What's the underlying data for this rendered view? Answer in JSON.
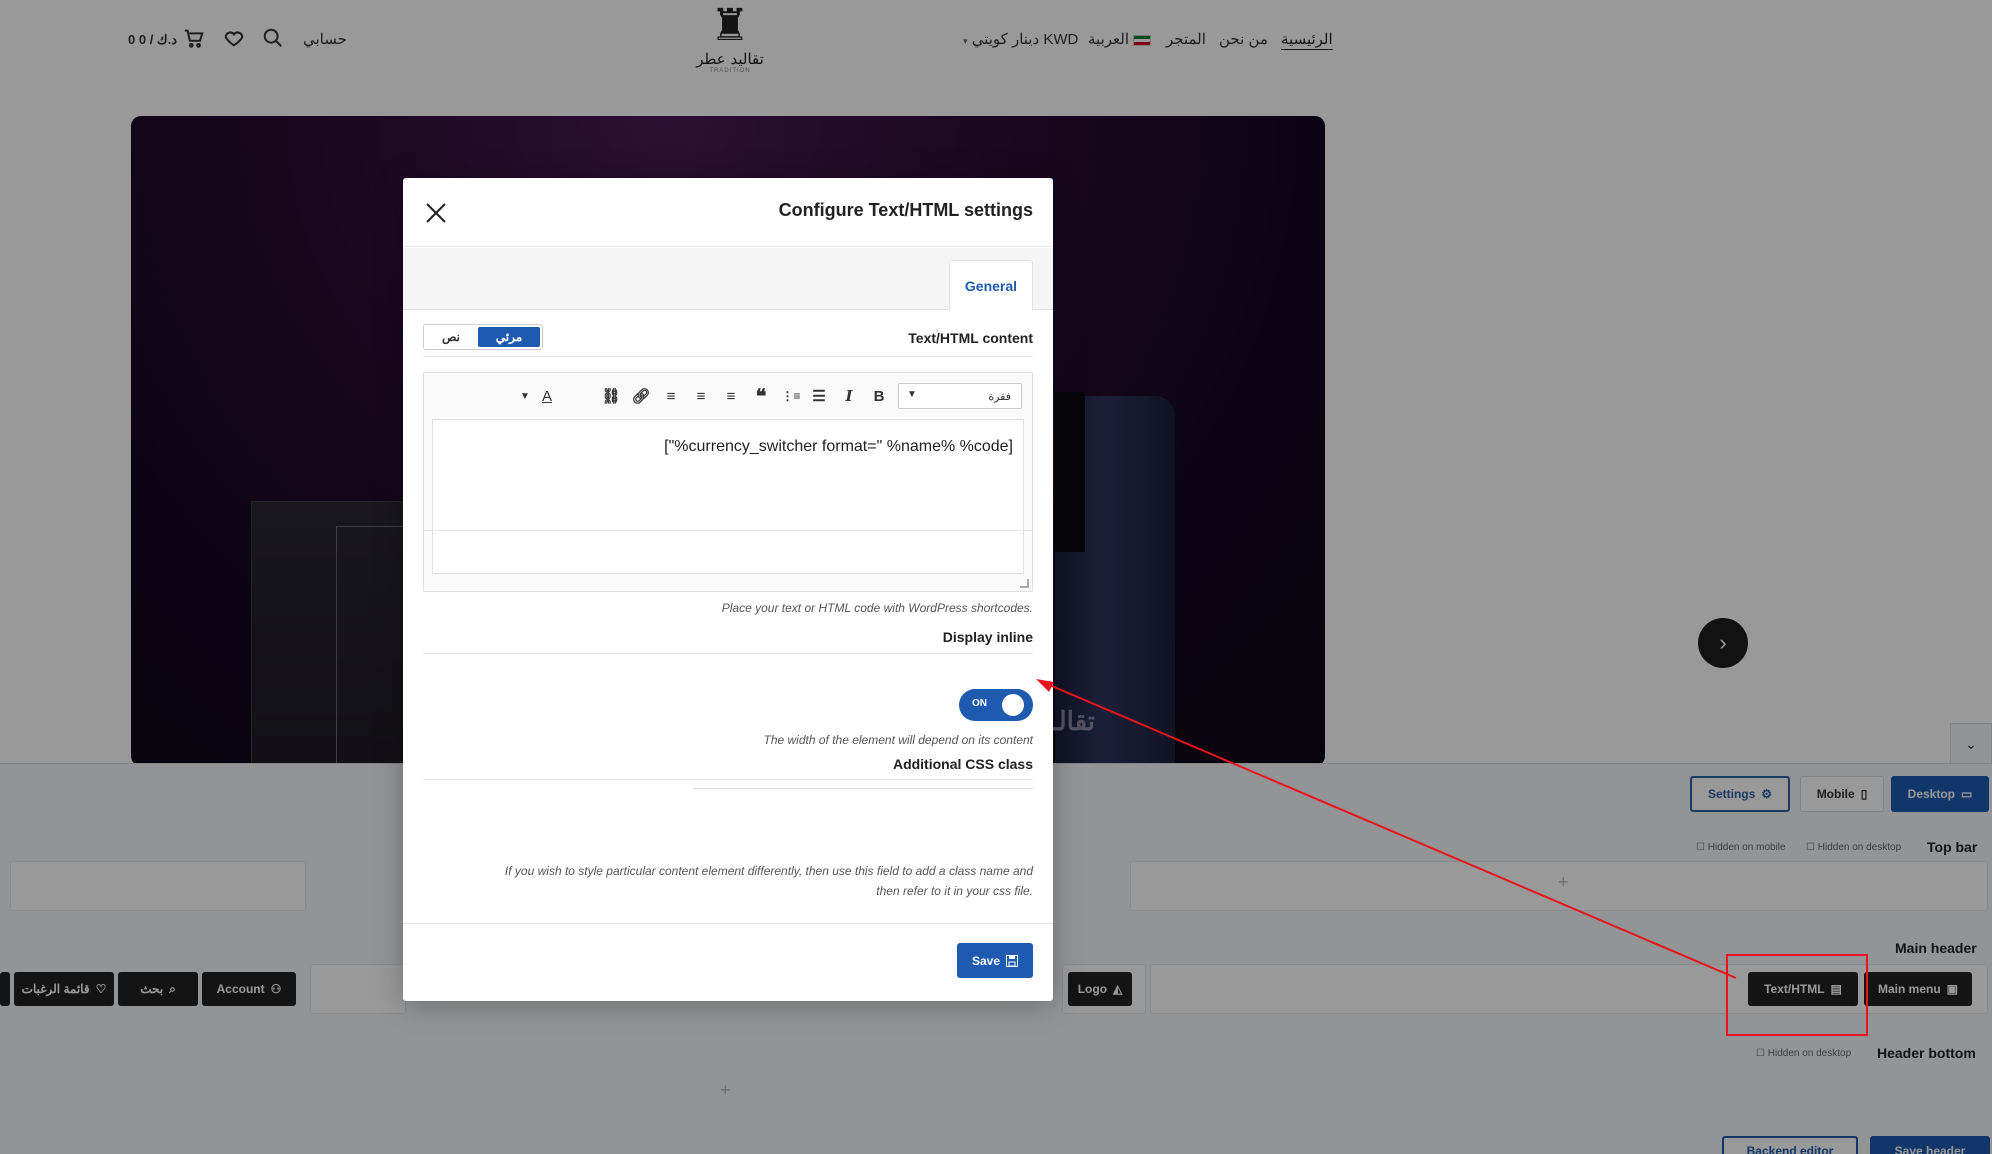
{
  "site": {
    "nav": {
      "home": "الرئيسية",
      "about": "من نحن",
      "shop": "المتجر",
      "language": "العربية",
      "currency": "دينار كويتي KWD",
      "account": "حسابي",
      "cart": "0 د.ك / 0"
    },
    "logo": {
      "name": "تقاليد عطر",
      "sub": "TRADITION"
    },
    "hero_brand": "تقالـ"
  },
  "builder": {
    "buttons": {
      "settings": "Settings",
      "mobile": "Mobile",
      "desktop": "Desktop"
    },
    "rows": {
      "top_bar": "Top bar",
      "main_header": "Main header",
      "header_bottom": "Header bottom",
      "hidden_mobile": "Hidden on mobile",
      "hidden_desktop": "Hidden on desktop"
    },
    "elements": {
      "main_menu": "Main menu",
      "text_html": "Text/HTML",
      "logo": "Logo",
      "account": "Account",
      "search": "بحث",
      "wishlist": "قائمة الرغبات"
    },
    "bottom": {
      "backend_editor": "Backend editor",
      "save_header": "Save header"
    }
  },
  "modal": {
    "title": "Configure Text/HTML settings",
    "tab_general": "General",
    "content_label": "Text/HTML content",
    "mode_visual": "مرئي",
    "mode_text": "نص",
    "format_value": "فقرة",
    "editor_content": "[\"%currency_switcher format=\" %name% %code]",
    "content_desc": "Place your text or HTML code with WordPress shortcodes.",
    "display_inline_label": "Display inline",
    "toggle_on": "ON",
    "display_inline_desc": "The width of the element will depend on its content",
    "css_label": "Additional CSS class",
    "css_value": "",
    "css_desc_1": "If you wish to style particular content element differently, then use this field to add a class name and",
    "css_desc_2": "then refer to it in your css file.",
    "save": "Save"
  },
  "colors": {
    "accent": "#1d5ab0",
    "annotation": "#e8141d",
    "dark_button": "#222222"
  }
}
